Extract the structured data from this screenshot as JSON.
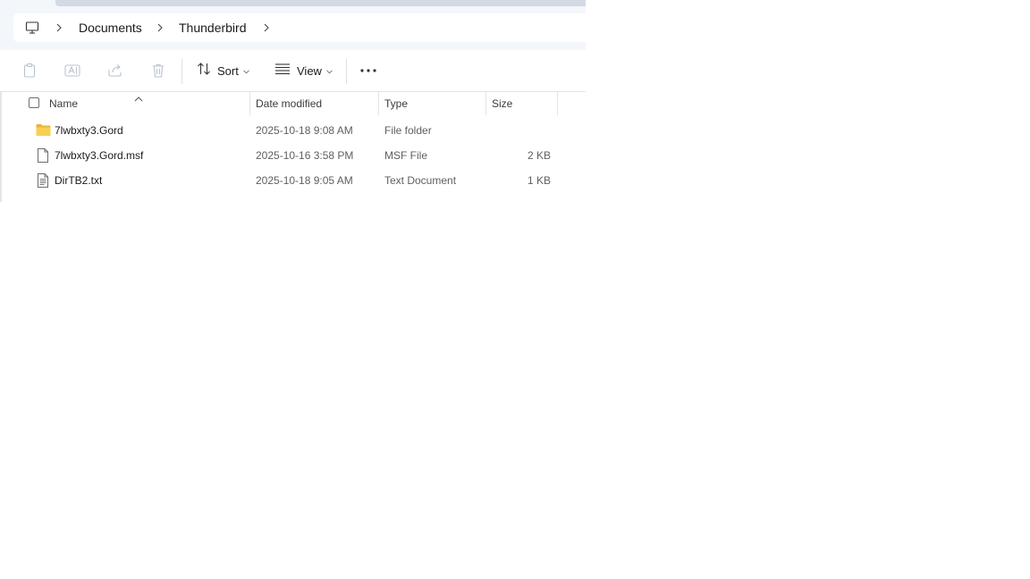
{
  "breadcrumb": {
    "items": [
      "Documents",
      "Thunderbird"
    ]
  },
  "toolbar": {
    "sort_label": "Sort",
    "view_label": "View",
    "icons": [
      "copy-icon",
      "rename-icon",
      "share-icon",
      "delete-icon",
      "sort-icon",
      "view-icon",
      "more-icon"
    ]
  },
  "columns": {
    "name": "Name",
    "date": "Date modified",
    "type": "Type",
    "size": "Size"
  },
  "files": [
    {
      "name": "7lwbxty3.Gord",
      "date": "2025-10-18 9:08 AM",
      "type": "File folder",
      "size": "",
      "icon": "folder-icon"
    },
    {
      "name": "7lwbxty3.Gord.msf",
      "date": "2025-10-16 3:58 PM",
      "type": "MSF File",
      "size": "2 KB",
      "icon": "file-icon"
    },
    {
      "name": "DirTB2.txt",
      "date": "2025-10-18 9:05 AM",
      "type": "Text Document",
      "size": "1 KB",
      "icon": "text-file-icon"
    }
  ],
  "colors": {
    "top_band": "#f3f6fb",
    "folder": "#f5c542",
    "disabled_icon": "#b8c2cf"
  }
}
